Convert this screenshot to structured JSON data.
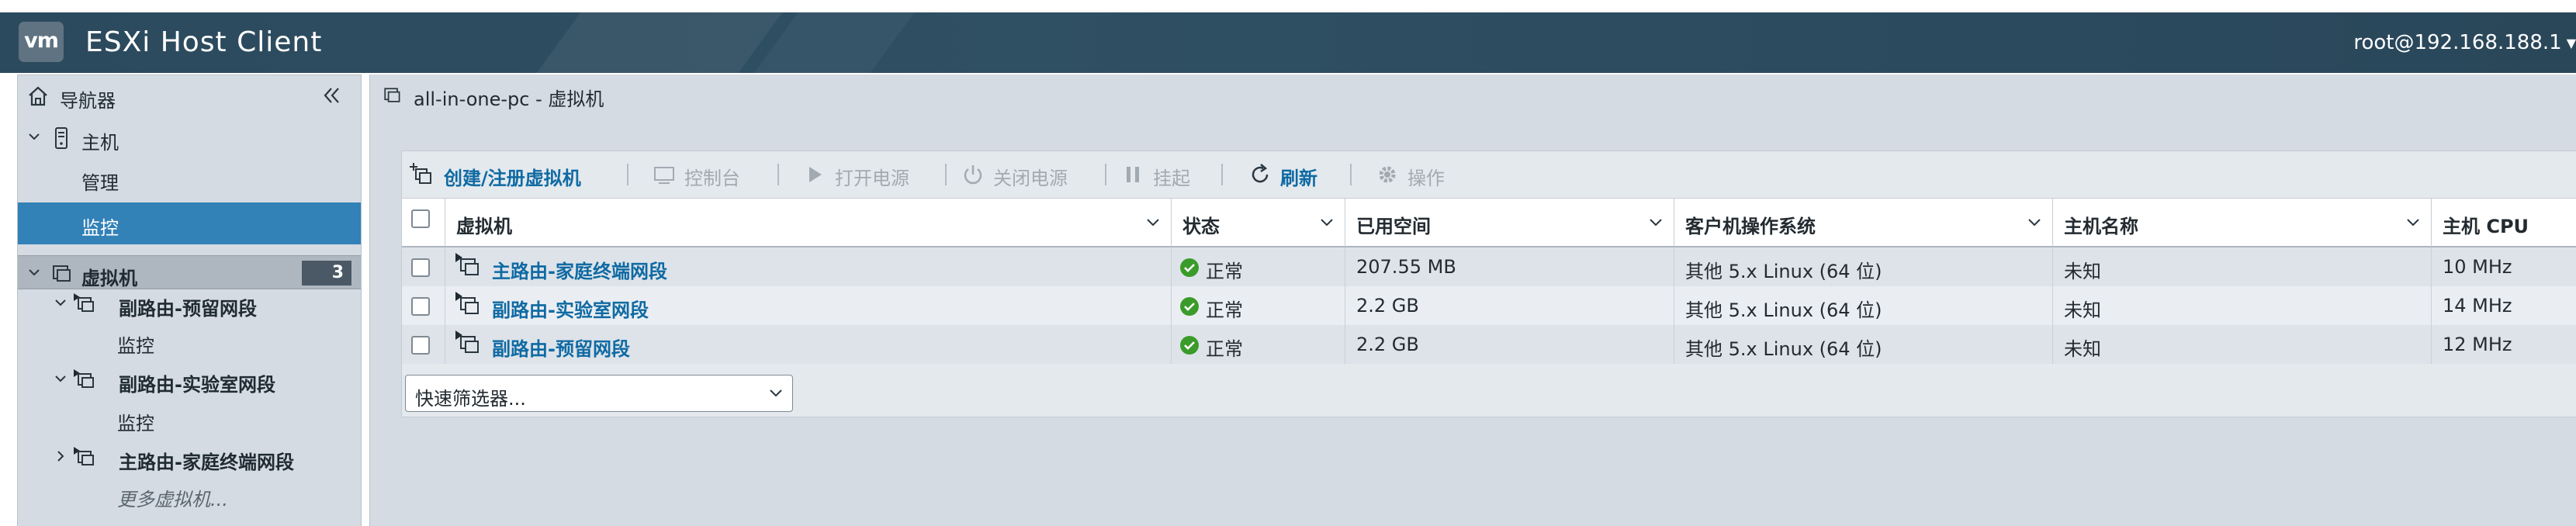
{
  "header": {
    "logo_text": "vm",
    "app_title": "ESXi Host Client",
    "user": "root@192.168.188.1",
    "colors": {
      "header_bg": "#2f4f63",
      "accent": "#3281b7",
      "link": "#0f6aa3",
      "ok": "#3a9b2a"
    }
  },
  "sidebar": {
    "title": "导航器",
    "host_label": "主机",
    "manage_label": "管理",
    "monitor_label": "监控",
    "vms_label": "虚拟机",
    "vm_count": "3",
    "vm_items": [
      {
        "name": "副路由-预留网段",
        "sub": "监控",
        "expanded": true
      },
      {
        "name": "副路由-实验室网段",
        "sub": "监控",
        "expanded": true
      },
      {
        "name": "主路由-家庭终端网段",
        "expanded": false
      }
    ],
    "more_label": "更多虚拟机..."
  },
  "main": {
    "title": "all-in-one-pc - 虚拟机",
    "toolbar": {
      "create": "创建/注册虚拟机",
      "console": "控制台",
      "power_on": "打开电源",
      "power_off": "关闭电源",
      "suspend": "挂起",
      "refresh": "刷新",
      "actions": "操作"
    },
    "columns": [
      "虚拟机",
      "状态",
      "已用空间",
      "客户机操作系统",
      "主机名称",
      "主机 CPU"
    ],
    "rows": [
      {
        "name": "主路由-家庭终端网段",
        "status": "正常",
        "used": "207.55 MB",
        "os": "其他 5.x Linux (64 位)",
        "hostname": "未知",
        "cpu": "10 MHz"
      },
      {
        "name": "副路由-实验室网段",
        "status": "正常",
        "used": "2.2 GB",
        "os": "其他 5.x Linux (64 位)",
        "hostname": "未知",
        "cpu": "14 MHz"
      },
      {
        "name": "副路由-预留网段",
        "status": "正常",
        "used": "2.2 GB",
        "os": "其他 5.x Linux (64 位)",
        "hostname": "未知",
        "cpu": "12 MHz"
      }
    ],
    "quick_filter": "快速筛选器..."
  }
}
